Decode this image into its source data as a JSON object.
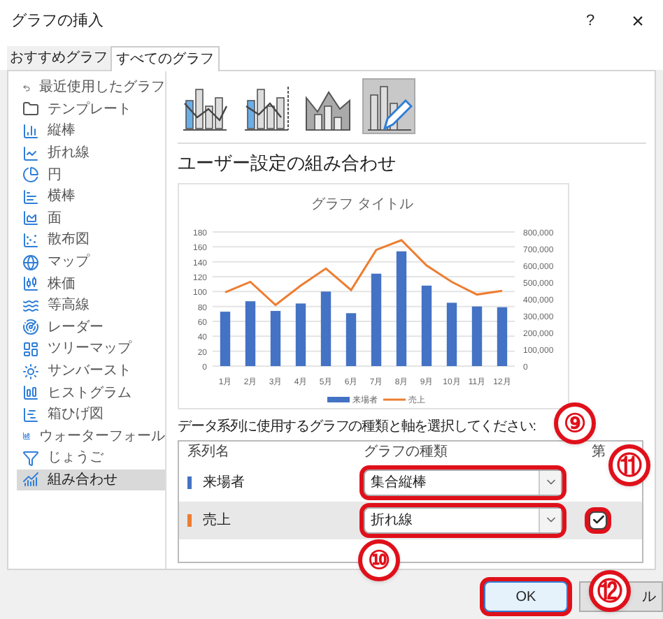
{
  "window": {
    "title": "グラフの挿入",
    "help": "?",
    "close": "×"
  },
  "tabs": [
    {
      "label": "おすすめグラフ",
      "selected": false
    },
    {
      "label": "すべてのグラフ",
      "selected": true
    }
  ],
  "sidebar": {
    "items": [
      {
        "label": "最近使用したグラフ",
        "selected": false
      },
      {
        "label": "テンプレート",
        "selected": false
      },
      {
        "label": "縦棒",
        "selected": false
      },
      {
        "label": "折れ線",
        "selected": false
      },
      {
        "label": "円",
        "selected": false
      },
      {
        "label": "横棒",
        "selected": false
      },
      {
        "label": "面",
        "selected": false
      },
      {
        "label": "散布図",
        "selected": false
      },
      {
        "label": "マップ",
        "selected": false
      },
      {
        "label": "株価",
        "selected": false
      },
      {
        "label": "等高線",
        "selected": false
      },
      {
        "label": "レーダー",
        "selected": false
      },
      {
        "label": "ツリーマップ",
        "selected": false
      },
      {
        "label": "サンバースト",
        "selected": false
      },
      {
        "label": "ヒストグラム",
        "selected": false
      },
      {
        "label": "箱ひげ図",
        "selected": false
      },
      {
        "label": "ウォーターフォール",
        "selected": false
      },
      {
        "label": "じょうご",
        "selected": false
      },
      {
        "label": "組み合わせ",
        "selected": true
      }
    ]
  },
  "chart_types": [
    {
      "kind": "clustered",
      "selected": false
    },
    {
      "kind": "secondary",
      "selected": false
    },
    {
      "kind": "area",
      "selected": false
    },
    {
      "kind": "custom",
      "selected": true
    }
  ],
  "heading": "ユーザー設定の組み合わせ",
  "chart_data": {
    "type": "bar",
    "title": "グラフ タイトル",
    "categories": [
      "1月",
      "2月",
      "3月",
      "4月",
      "5月",
      "6月",
      "7月",
      "8月",
      "9月",
      "10月",
      "11月",
      "12月"
    ],
    "series": [
      {
        "name": "来場者",
        "type": "bar",
        "color": "#4472c4",
        "values": [
          73,
          87,
          74,
          84,
          100,
          71,
          124,
          154,
          108,
          85,
          80,
          79
        ]
      },
      {
        "name": "売上",
        "type": "line",
        "color": "#ed7d31",
        "values": [
          99,
          113,
          82,
          108,
          131,
          102,
          156,
          169,
          135,
          113,
          96,
          101
        ]
      }
    ],
    "ylim": [
      0,
      180
    ],
    "yticks": [
      0,
      20,
      40,
      60,
      80,
      100,
      120,
      140,
      160,
      180
    ],
    "grid": true,
    "legend": "bottom",
    "annotations": [
      {
        "text": "0"
      },
      {
        "text": "100,000"
      },
      {
        "text": "200,000"
      },
      {
        "text": "300,000"
      },
      {
        "text": "400,000"
      },
      {
        "text": "500,000"
      },
      {
        "text": "600,000"
      },
      {
        "text": "700,000"
      },
      {
        "text": "800,000"
      }
    ]
  },
  "series_prompt": "データ系列に使用するグラフの種類と軸を選択してください:",
  "series_table": {
    "columns": [
      "系列名",
      "グラフの種類",
      "第"
    ],
    "rows": [
      {
        "name": "来場者",
        "color": "#4472c4",
        "selected": false,
        "chart_type": {
          "value": "集合縦棒",
          "highlighted": true
        }
      },
      {
        "name": "売上",
        "color": "#ed7d31",
        "selected": true,
        "chart_type": {
          "value": "折れ線",
          "highlighted": true
        },
        "secondary_axis": {
          "checked": true,
          "highlighted": true
        }
      }
    ]
  },
  "buttons": [
    {
      "label": "OK",
      "highlighted": true
    },
    {
      "label": "ル",
      "highlighted": false
    }
  ],
  "annotations": [
    {
      "label": "⑨"
    },
    {
      "label": "⑩"
    },
    {
      "label": "⑪"
    },
    {
      "label": "⑫"
    }
  ]
}
